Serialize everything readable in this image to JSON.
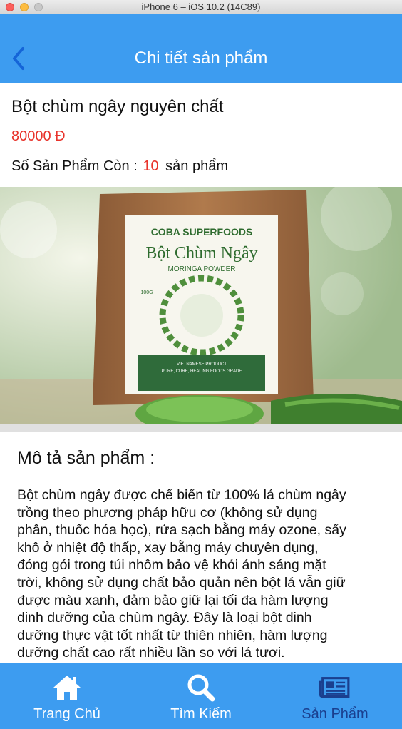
{
  "simulator": {
    "title": "iPhone 6 – iOS 10.2 (14C89)"
  },
  "nav": {
    "title": "Chi tiết sản phẩm",
    "back_icon": "chevron-left-icon"
  },
  "product": {
    "name": "Bột chùm ngây nguyên chất",
    "price": "80000 Đ",
    "stock_label": "Số Sản Phẩm Còn :",
    "stock_count": "10",
    "stock_unit": "sản phẩm",
    "image": {
      "brand": "COBA SUPERFOODS",
      "title": "Bột Chùm Ngây",
      "subtitle": "MORINGA POWDER",
      "weight": "100G",
      "tagline_1": "VIETNAMESE PRODUCT",
      "tagline_2": "PURE, CURE, HEALING FOODS GRADE"
    }
  },
  "description": {
    "title": "Mô tả sản phẩm :",
    "lines": [
      "Bột chùm ngây được chế biến từ 100% lá chùm ngây",
      "trồng theo phương pháp hữu cơ (không sử dụng",
      "phân, thuốc hóa học), rửa sạch bằng máy ozone, sấy",
      "khô ở nhiệt độ thấp, xay bằng máy chuyên dụng,",
      "đóng gói trong túi nhôm bảo vệ khỏi ánh sáng mặt",
      "trời, không sử dụng chất bảo quản nên bột lá vẫn giữ",
      "được màu xanh, đảm bảo giữ lại tối đa hàm lượng",
      "dinh dưỡng của chùm ngây. Đây là loại bột dinh",
      "dưỡng thực vật tốt nhất từ thiên nhiên, hàm lượng",
      "dưỡng chất cao rất nhiều lần so với lá tươi."
    ]
  },
  "tabs": [
    {
      "label": "Trang Chủ",
      "icon": "home-icon",
      "active": false
    },
    {
      "label": "Tìm Kiếm",
      "icon": "search-icon",
      "active": false
    },
    {
      "label": "Sản Phẩm",
      "icon": "newspaper-icon",
      "active": true
    }
  ],
  "colors": {
    "primary": "#3d9cf0",
    "price": "#e8332b",
    "active_tab": "#1a3f8f"
  }
}
